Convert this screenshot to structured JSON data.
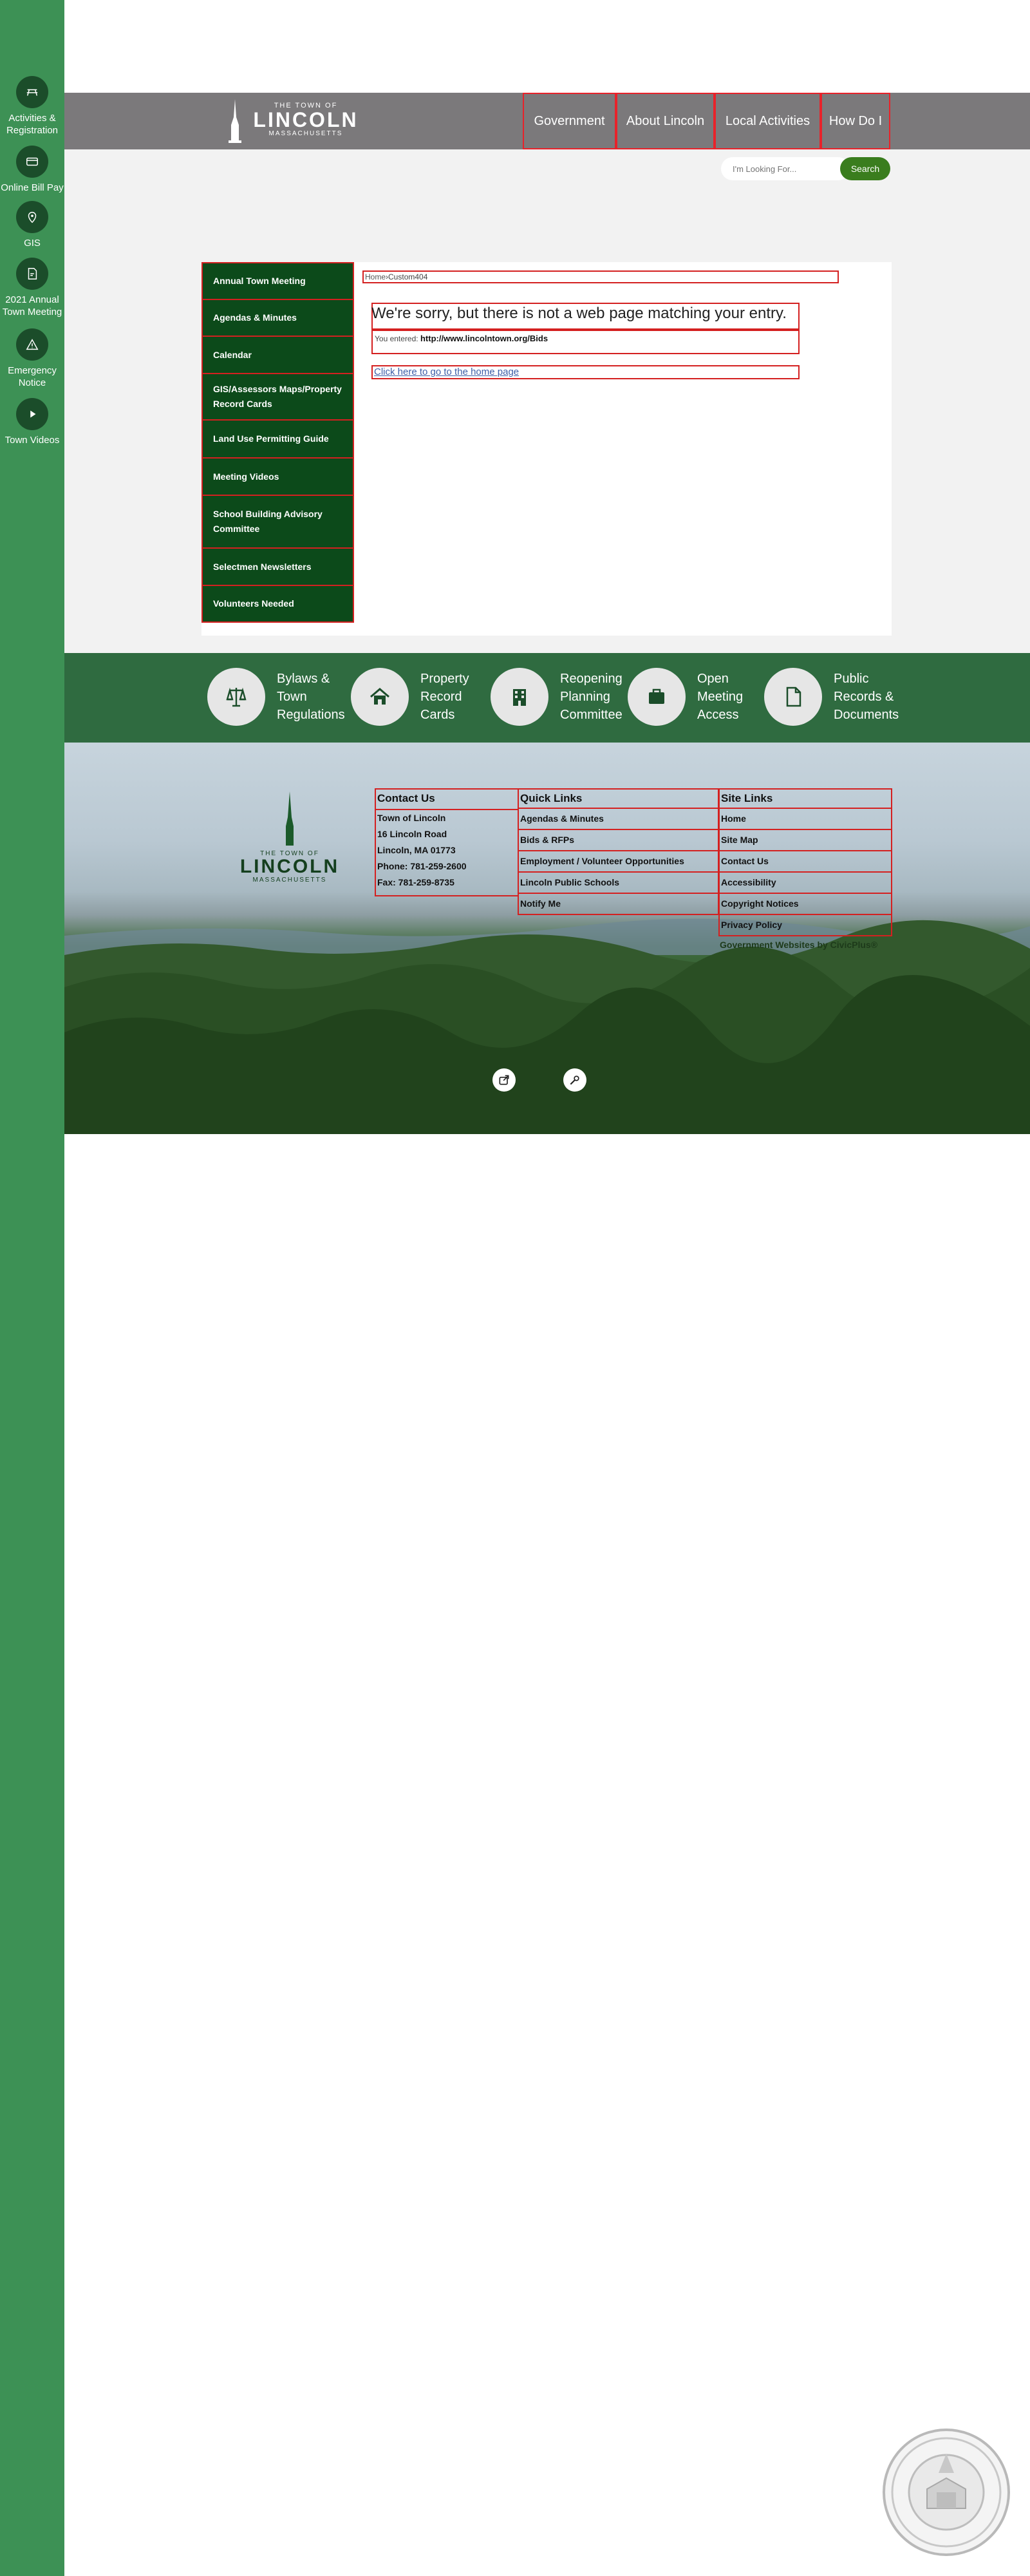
{
  "sidebar": {
    "items": [
      {
        "label": "Activities & Registration",
        "icon": "picnic-table-icon"
      },
      {
        "label": "Online Bill Pay",
        "icon": "credit-card-icon"
      },
      {
        "label": "GIS",
        "icon": "map-pin-icon"
      },
      {
        "label": "2021 Annual Town Meeting",
        "icon": "document-icon"
      },
      {
        "label": "Emergency Notice",
        "icon": "warning-icon"
      },
      {
        "label": "Town Videos",
        "icon": "play-icon"
      }
    ]
  },
  "header": {
    "logo": {
      "line1": "THE TOWN OF",
      "line2": "LINCOLN",
      "line3": "MASSACHUSETTS"
    },
    "nav": [
      "Government",
      "About Lincoln",
      "Local Activities",
      "How Do I"
    ]
  },
  "search": {
    "placeholder": "I'm Looking For...",
    "button": "Search"
  },
  "leftnav": [
    "Annual Town Meeting",
    "Agendas & Minutes",
    "Calendar",
    "GIS/Assessors Maps/Property Record Cards",
    "Land Use Permitting Guide",
    "Meeting Videos",
    "School Building Advisory Committee",
    "Selectmen Newsletters",
    "Volunteers Needed"
  ],
  "breadcrumb": {
    "home": "Home",
    "separator": "›",
    "current": "Custom404"
  },
  "error": {
    "title": "We're sorry, but there is not a web page matching your entry.",
    "entered_label": "You entered:",
    "entered_url": "http://www.lincolntown.org/Bids",
    "home_link": "Click here to go to the home page"
  },
  "features": [
    {
      "label": "Bylaws & Town Regulations",
      "icon": "scales-icon"
    },
    {
      "label": "Property Record Cards",
      "icon": "house-icon"
    },
    {
      "label": "Reopening Planning Committee",
      "icon": "building-icon"
    },
    {
      "label": "Open Meeting Access",
      "icon": "briefcase-icon"
    },
    {
      "label": "Public Records & Documents",
      "icon": "file-icon"
    }
  ],
  "footer": {
    "logo": {
      "line1": "THE TOWN OF",
      "line2": "LINCOLN",
      "line3": "MASSACHUSETTS"
    },
    "contact": {
      "heading": "Contact Us",
      "lines": [
        "Town of Lincoln",
        "16 Lincoln Road",
        "Lincoln, MA 01773",
        "Phone: 781-259-2600",
        "Fax: 781-259-8735"
      ]
    },
    "quick_links": {
      "heading": "Quick Links",
      "items": [
        "Agendas & Minutes",
        "Bids & RFPs",
        "Employment / Volunteer Opportunities",
        "Lincoln Public Schools",
        "Notify Me"
      ]
    },
    "site_links": {
      "heading": "Site Links",
      "items": [
        "Home",
        "Site Map",
        "Contact Us",
        "Accessibility",
        "Copyright Notices",
        "Privacy Policy",
        "Government Websites by CivicPlus®"
      ]
    }
  },
  "colors": {
    "sidebar": "#3d9155",
    "header": "#7b797b",
    "nav_green": "#0c4a1a",
    "feature_band": "#2f6b40",
    "search_button": "#3a7d1e"
  }
}
